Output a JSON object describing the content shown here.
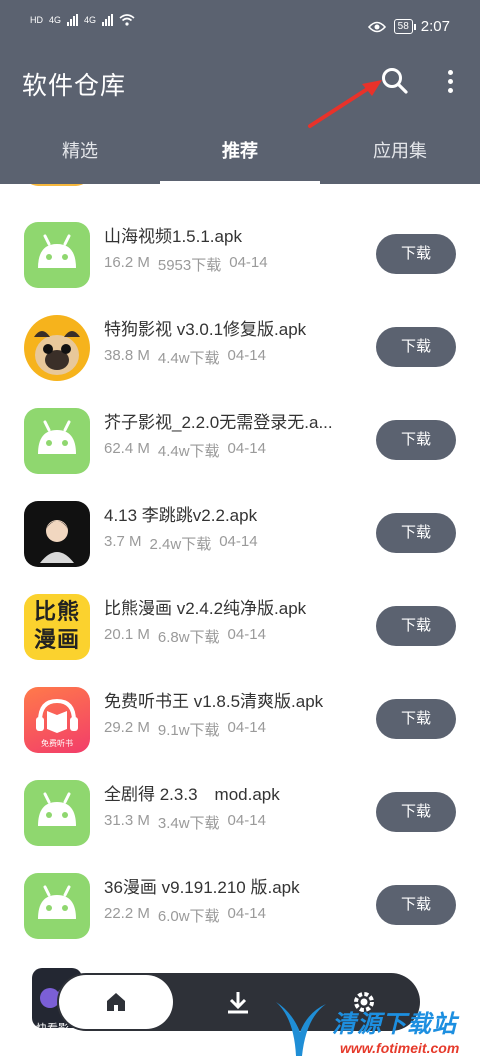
{
  "status": {
    "time": "2:07",
    "battery": "58",
    "left_labels": [
      "HD",
      "4G",
      "4G"
    ]
  },
  "header": {
    "title": "软件仓库",
    "icons": [
      "search-icon",
      "more-vert-icon"
    ]
  },
  "tabs": [
    {
      "label": "精选",
      "active": false
    },
    {
      "label": "推荐",
      "active": true
    },
    {
      "label": "应用集",
      "active": false
    }
  ],
  "apps": [
    {
      "name": "山海视频1.5.1.apk",
      "size": "16.2 M",
      "downloads": "5953下载",
      "date": "04-14",
      "icon": "android-icon",
      "button": "下载"
    },
    {
      "name": "特狗影视 v3.0.1修复版.apk",
      "size": "38.8 M",
      "downloads": "4.4w下载",
      "date": "04-14",
      "icon": "pug-app-icon",
      "button": "下载"
    },
    {
      "name": "芥子影视_2.2.0无需登录无.a...",
      "size": "62.4 M",
      "downloads": "4.4w下载",
      "date": "04-14",
      "icon": "android-icon",
      "button": "下载"
    },
    {
      "name": "4.13 李跳跳v2.2.apk",
      "size": "3.7 M",
      "downloads": "2.4w下载",
      "date": "04-14",
      "icon": "avatar-app-icon",
      "button": "下载"
    },
    {
      "name": "比熊漫画 v2.4.2纯净版.apk",
      "size": "20.1 M",
      "downloads": "6.8w下载",
      "date": "04-14",
      "icon": "bixiong-app-icon",
      "icon_text": "比熊漫画",
      "button": "下载"
    },
    {
      "name": "免费听书王 v1.8.5清爽版.apk",
      "size": "29.2 M",
      "downloads": "9.1w下载",
      "date": "04-14",
      "icon": "audiobook-app-icon",
      "icon_text": "免费听书",
      "button": "下载"
    },
    {
      "name": "全剧得 2.3.3　mod.apk",
      "size": "31.3 M",
      "downloads": "3.4w下载",
      "date": "04-14",
      "icon": "android-icon",
      "button": "下载"
    },
    {
      "name": "36漫画 v9.191.210 版.apk",
      "size": "22.2 M",
      "downloads": "6.0w下载",
      "date": "04-14",
      "icon": "android-icon",
      "button": "下载"
    }
  ],
  "bottom_nav": {
    "items": [
      "home-icon",
      "download-icon",
      "settings-icon"
    ]
  },
  "peek": {
    "label": "快看影"
  },
  "watermark": {
    "title": "清源下载站",
    "url": "www.fotimeit.com"
  },
  "colors": {
    "appbar": "#5b6270",
    "button": "#5b6270",
    "android_green": "#8fd76f",
    "text_secondary": "#9a9a9a"
  }
}
